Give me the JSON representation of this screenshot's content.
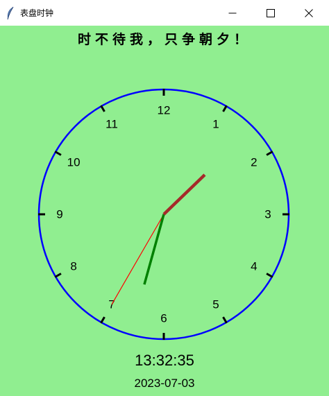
{
  "window": {
    "title": "表盘时钟",
    "app_icon": "feather-icon",
    "controls": [
      "minimize-icon",
      "maximize-icon",
      "close-icon"
    ]
  },
  "motto": "时不待我，只争朝夕！",
  "clock": {
    "numerals": [
      "12",
      "1",
      "2",
      "3",
      "4",
      "5",
      "6",
      "7",
      "8",
      "9",
      "10",
      "11"
    ],
    "time": {
      "hour": 13,
      "minute": 32,
      "second": 35
    },
    "colors": {
      "background": "#90ee90",
      "dial": "#0000ff",
      "ticks": "#000000",
      "hour_hand": "#a52a2a",
      "minute_hand": "#008000",
      "second_hand": "#ff0000"
    }
  },
  "digital_time": "13:32:35",
  "date": "2023-07-03"
}
